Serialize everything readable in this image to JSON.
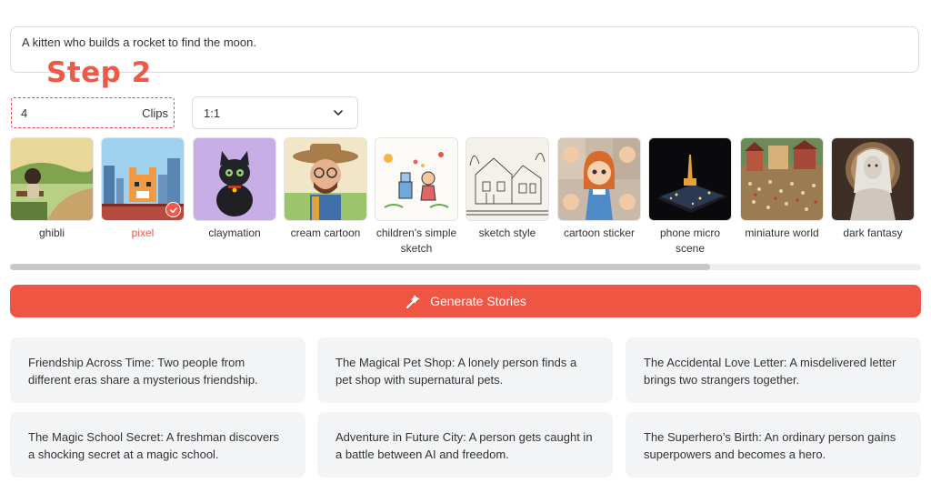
{
  "prompt": {
    "text": "A kitten who builds a rocket to find the moon."
  },
  "step": {
    "label": "Step 2"
  },
  "clips": {
    "value": "4",
    "unit": "Clips"
  },
  "ratio": {
    "value": "1:1"
  },
  "styles": [
    {
      "name": "ghibli",
      "selected": false
    },
    {
      "name": "pixel",
      "selected": true
    },
    {
      "name": "claymation",
      "selected": false
    },
    {
      "name": "cream cartoon",
      "selected": false
    },
    {
      "name": "children's simple sketch",
      "selected": false
    },
    {
      "name": "sketch style",
      "selected": false
    },
    {
      "name": "cartoon sticker",
      "selected": false
    },
    {
      "name": "phone micro scene",
      "selected": false
    },
    {
      "name": "miniature world",
      "selected": false
    },
    {
      "name": "dark fantasy",
      "selected": false
    }
  ],
  "generate": {
    "label": "Generate Stories"
  },
  "stories": [
    "Friendship Across Time: Two people from different eras share a mysterious friendship.",
    "The Magical Pet Shop: A lonely person finds a pet shop with supernatural pets.",
    "The Accidental Love Letter: A misdelivered letter brings two strangers together.",
    "The Magic School Secret: A freshman discovers a shocking secret at a magic school.",
    "Adventure in Future City: A person gets caught in a battle between AI and freedom.",
    "The Superhero’s Birth: An ordinary person gains superpowers and becomes a hero."
  ],
  "colors": {
    "accent": "#ee5643",
    "card_bg": "#f3f4f6",
    "step_red": "#ee5a47"
  },
  "icons": {
    "chevron": "chevron-down-icon",
    "check": "check-icon",
    "sparkle": "magic-wand-icon"
  }
}
